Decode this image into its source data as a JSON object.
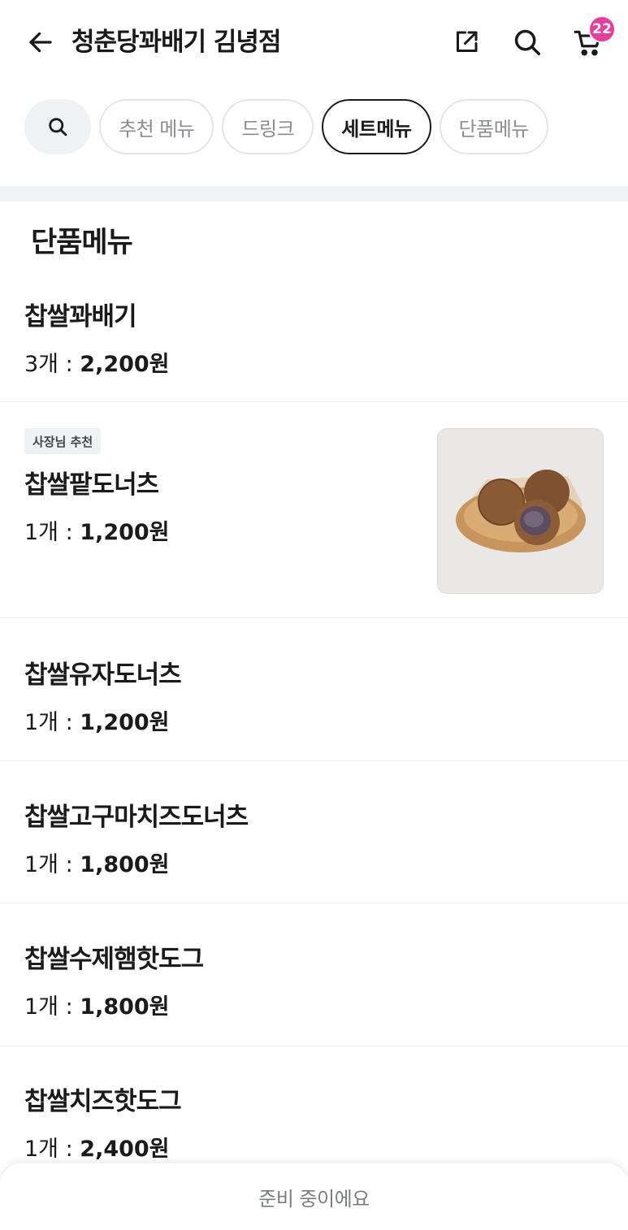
{
  "header": {
    "store_name": "청춘당꽈배기 김녕점",
    "cart_count": "22",
    "icons": {
      "back": "arrow-left-icon",
      "share": "share-external-icon",
      "search": "search-icon",
      "cart": "cart-icon"
    }
  },
  "categories": [
    {
      "label": "추천 메뉴",
      "active": false
    },
    {
      "label": "드링크",
      "active": false
    },
    {
      "label": "세트메뉴",
      "active": true
    },
    {
      "label": "단품메뉴",
      "active": false
    }
  ],
  "section": {
    "title": "단품메뉴"
  },
  "items": [
    {
      "name": "찹쌀꽈배기",
      "qty": "3개 : ",
      "price": "2,200원"
    },
    {
      "name": "찹쌀팥도너츠",
      "qty": "1개 : ",
      "price": "1,200원",
      "badge": "사장님 추천",
      "has_image": true
    },
    {
      "name": "찹쌀유자도너츠",
      "qty": "1개 : ",
      "price": "1,200원"
    },
    {
      "name": "찹쌀고구마치즈도너츠",
      "qty": "1개 : ",
      "price": "1,800원"
    },
    {
      "name": "찹쌀수제햄핫도그",
      "qty": "1개 : ",
      "price": "1,800원"
    },
    {
      "name": "찹쌀치즈핫도그",
      "qty": "1개 : ",
      "price": "2,400원"
    }
  ],
  "bottom_bar": {
    "status": "준비 중이에요"
  },
  "colors": {
    "badge": "#e83e9a",
    "text": "#1a1a1a",
    "muted": "#8a8d93"
  }
}
